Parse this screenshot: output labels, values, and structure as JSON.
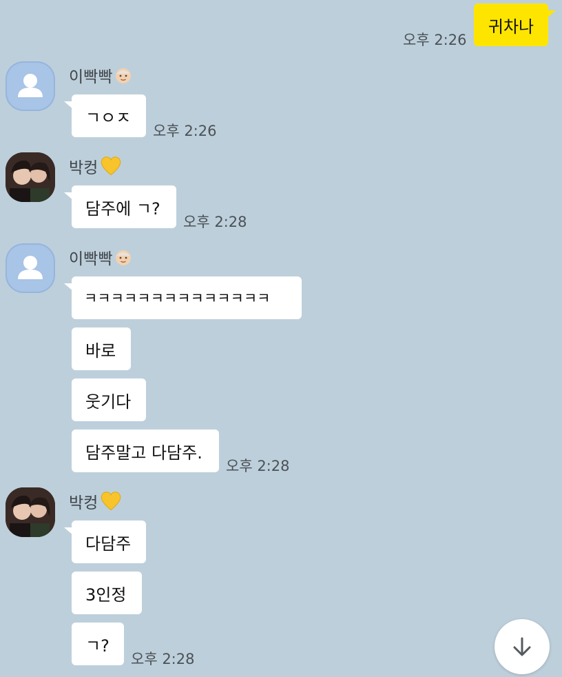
{
  "messages": {
    "m0": {
      "text": "귀차나",
      "time": "오후 2:26"
    },
    "g1": {
      "sender": "이빡빡",
      "m1": "ㄱㅇㅈ",
      "time": "오후 2:26"
    },
    "g2": {
      "sender": "박컹",
      "m1": "담주에 ㄱ?",
      "time": "오후 2:28"
    },
    "g3": {
      "sender": "이빡빡",
      "m1": "ㅋㅋㅋㅋㅋㅋㅋㅋㅋㅋㅋㅋㅋㅋ",
      "m2": "바로",
      "m3": "웃기다",
      "m4": "담주말고 다담주.",
      "time": "오후 2:28"
    },
    "g4": {
      "sender": "박컹",
      "m1": "다담주",
      "m2": "3인정",
      "m3": "ㄱ?",
      "time": "오후 2:28"
    }
  },
  "icons": {
    "emoji_lee": "older-person-emoji",
    "emoji_park": "yellow-heart-emoji",
    "scroll": "arrow-down-icon"
  },
  "colors": {
    "background": "#bdcfdb",
    "my_bubble": "#fee500",
    "other_bubble": "#ffffff",
    "default_avatar": "#a8c4e6"
  }
}
